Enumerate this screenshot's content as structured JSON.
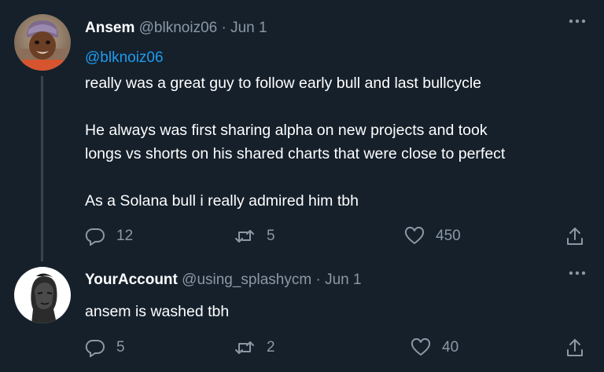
{
  "tweet1": {
    "display_name": "Ansem",
    "handle": "@blknoiz06",
    "separator": "·",
    "date": "Jun 1",
    "mention": "@blknoiz06",
    "lines": [
      "really was a great guy to follow early bull and last bullcycle",
      "He always was first sharing alpha on new projects and took",
      "longs vs shorts on his shared charts that were close to perfect",
      "As a Solana bull i really admired him tbh"
    ],
    "reply_count": "12",
    "retweet_count": "5",
    "like_count": "450"
  },
  "tweet2": {
    "display_name": "YourAccount",
    "handle": "@using_splashycm",
    "separator": "·",
    "date": "Jun 1",
    "text": "ansem is washed tbh",
    "reply_count": "5",
    "retweet_count": "2",
    "like_count": "40"
  },
  "icons": {
    "more": "more-horizontal-icon",
    "reply": "reply-bubble-icon",
    "retweet": "retweet-arrows-icon",
    "like": "heart-icon",
    "share": "share-upload-icon"
  },
  "colors": {
    "background": "#15202b",
    "text": "#ffffff",
    "muted": "#8b98a5",
    "link": "#1d9bf0",
    "thread_line": "#38444d"
  }
}
